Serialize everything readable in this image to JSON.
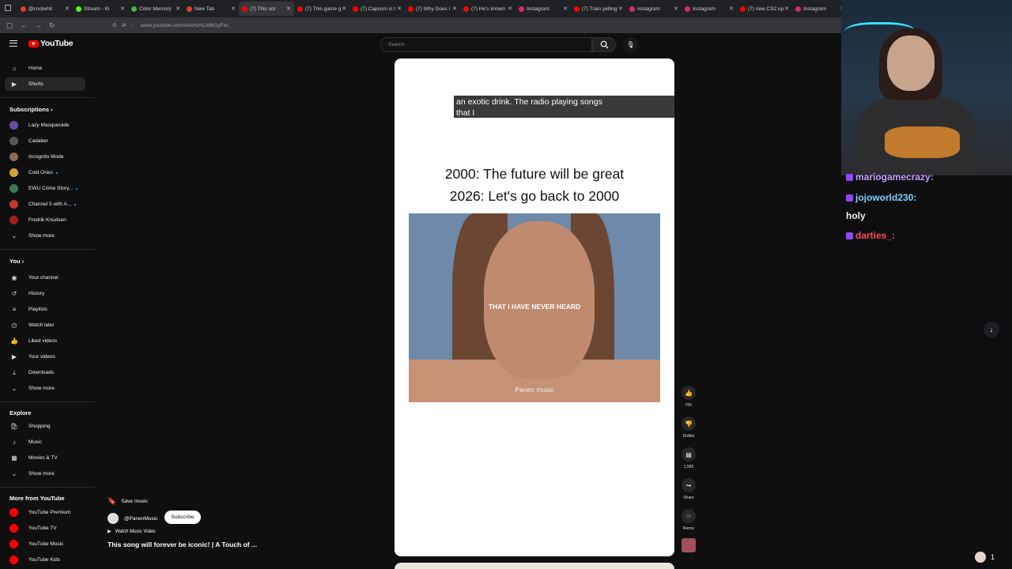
{
  "browser": {
    "tabs": [
      {
        "label": "@coolwhit",
        "color": "#e53935"
      },
      {
        "label": "Stream - Ki",
        "color": "#53fc18"
      },
      {
        "label": "Color Memory",
        "color": "#4caf50"
      },
      {
        "label": "New Tab",
        "color": "#e53935"
      },
      {
        "label": "(7) This sor",
        "color": "#ff0000"
      },
      {
        "label": "(7) This game g",
        "color": "#ff0000"
      },
      {
        "label": "(7) Capcom is t",
        "color": "#ff0000"
      },
      {
        "label": "(7) Why Does I",
        "color": "#ff0000"
      },
      {
        "label": "(7) He's known",
        "color": "#ff0000"
      },
      {
        "label": "Instagram",
        "color": "#d62976"
      },
      {
        "label": "(7) Train yelling",
        "color": "#ff0000"
      },
      {
        "label": "Instagram",
        "color": "#d62976"
      },
      {
        "label": "Instagram",
        "color": "#d62976"
      },
      {
        "label": "(7) new CS2 up",
        "color": "#ff0000"
      },
      {
        "label": "Instagram",
        "color": "#d62976"
      }
    ],
    "active_tab_index": 4,
    "url": "www.youtube.com/shorts/NLli8hGyFkc"
  },
  "youtube": {
    "logo_text": "YouTube",
    "search_placeholder": "Search",
    "nav": [
      {
        "label": "Home",
        "icon": "home-icon",
        "glyph": "⌂"
      },
      {
        "label": "Shorts",
        "icon": "shorts-icon",
        "glyph": "▶"
      }
    ],
    "subscriptions_heading": "Subscriptions",
    "subscriptions": [
      {
        "label": "Lazy Masquerade",
        "color": "#6b4e9b",
        "live": false
      },
      {
        "label": "Cadaber",
        "color": "#555",
        "live": false
      },
      {
        "label": "Incognito Mode",
        "color": "#8a6d5a",
        "live": false
      },
      {
        "label": "Cold Ones",
        "color": "#d4a537",
        "live": true
      },
      {
        "label": "EWU Crime Story...",
        "color": "#3b7a57",
        "live": true
      },
      {
        "label": "Channel 5 with A...",
        "color": "#c0392b",
        "live": true
      },
      {
        "label": "Fredrik Knudsen",
        "color": "#a02020",
        "live": false
      }
    ],
    "show_more": "Show more",
    "you_heading": "You",
    "you_items": [
      {
        "label": "Your channel",
        "glyph": "◉"
      },
      {
        "label": "History",
        "glyph": "↺"
      },
      {
        "label": "Playlists",
        "glyph": "≡"
      },
      {
        "label": "Watch later",
        "glyph": "◷"
      },
      {
        "label": "Liked videos",
        "glyph": "👍"
      },
      {
        "label": "Your videos",
        "glyph": "▶"
      },
      {
        "label": "Downloads",
        "glyph": "⤓"
      }
    ],
    "explore_heading": "Explore",
    "explore_items": [
      {
        "label": "Shopping",
        "glyph": "🛍"
      },
      {
        "label": "Music",
        "glyph": "♪"
      },
      {
        "label": "Movies & TV",
        "glyph": "▦"
      }
    ],
    "more_heading": "More from YouTube",
    "more_items": [
      {
        "label": "YouTube Premium"
      },
      {
        "label": "YouTube TV"
      },
      {
        "label": "YouTube Music"
      },
      {
        "label": "YouTube Kids"
      }
    ],
    "short": {
      "caption_line1": "an exotic drink. The radio playing songs",
      "caption_line2": "that I",
      "overlay_line1": "2000: The future will be great",
      "overlay_line2": "2026: Let's go back to 2000",
      "video_lyric": "THAT I HAVE NEVER HEARD",
      "video_watermark": "Panen music",
      "likes": "70K",
      "dislike_label": "Dislike",
      "comments": "1,585",
      "share_label": "Share",
      "remix_label": "Remix",
      "save_music": "Save music",
      "channel": "@PanenMusic",
      "subscribe": "Subscribe",
      "watch_music_video": "Watch Music Video",
      "title": "This song will forever be iconic! | A Touch of ..."
    }
  },
  "stream": {
    "chat": [
      {
        "user": "mariogamecrazy:",
        "color": "#c9a0ff",
        "message": ""
      },
      {
        "user": "jojoworld230:",
        "color": "#7ad1ff",
        "message": ""
      },
      {
        "user": "",
        "color": "#ffffff",
        "message": "holy"
      },
      {
        "user": "darties_:",
        "color": "#ff4d4d",
        "message": ""
      }
    ],
    "viewer_count": "1"
  }
}
